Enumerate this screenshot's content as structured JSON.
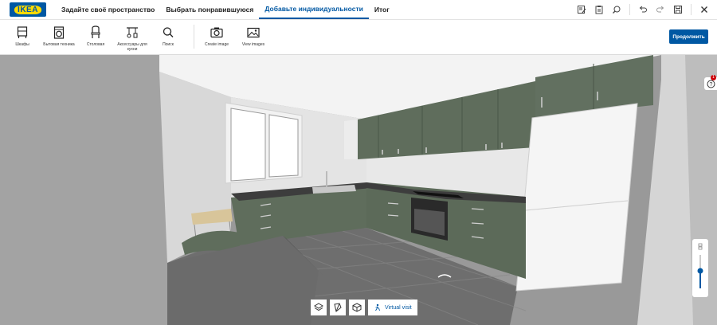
{
  "header": {
    "logo_text": "IKEA",
    "tabs": [
      {
        "label": "Задайте своё пространство"
      },
      {
        "label": "Выбрать понравившуюся"
      },
      {
        "label": "Добавьте индивидуальности"
      },
      {
        "label": "Итог"
      }
    ],
    "active_tab": "Добавьте индивидуальности",
    "icons": [
      "edit-list-icon",
      "clipboard-icon",
      "search-history-icon",
      "undo-icon",
      "redo-icon",
      "save-icon",
      "close-icon"
    ]
  },
  "toolbar": {
    "items": [
      {
        "label": "Шкафы",
        "icon": "cabinet-icon"
      },
      {
        "label": "Бытовая техника",
        "icon": "washing-machine-icon"
      },
      {
        "label": "Столовая",
        "icon": "chair-icon"
      },
      {
        "label": "Аксессуары для кухни",
        "icon": "kitchen-tools-icon"
      },
      {
        "label": "Поиск",
        "icon": "search-icon"
      },
      {
        "label": "Create image",
        "icon": "camera-icon"
      },
      {
        "label": "View images",
        "icon": "image-icon"
      }
    ],
    "continue_label": "Продолжить"
  },
  "viewport": {
    "help_badge": "1",
    "virtual_visit_label": "Virtual visit",
    "view_buttons": [
      "view-top-icon",
      "view-side-icon",
      "view-3d-icon"
    ]
  },
  "colors": {
    "brand_blue": "#0058a3",
    "brand_yellow": "#ffdb00",
    "cabinet_green": "#5f6d5c",
    "countertop": "#3d3d3d"
  }
}
